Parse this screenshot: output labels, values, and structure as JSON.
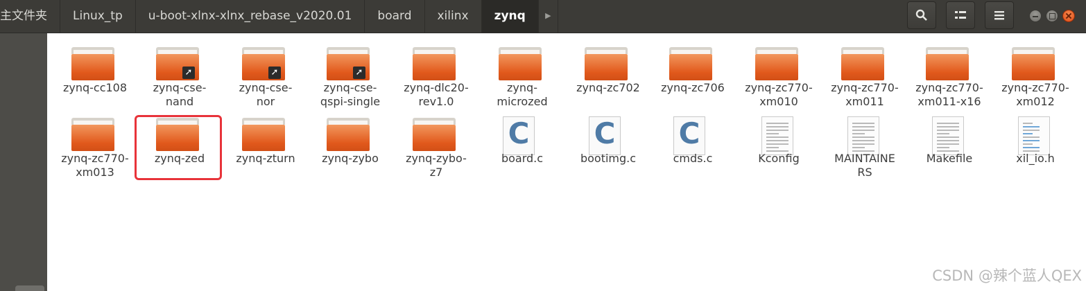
{
  "breadcrumbs": [
    "主文件夹",
    "Linux_tp",
    "u-boot-xlnx-xlnx_rebase_v2020.01",
    "board",
    "xilinx",
    "zynq"
  ],
  "active_crumb": "zynq",
  "toolbar": {
    "search_icon": "search-icon",
    "view_icon": "list-view-icon",
    "menu_icon": "hamburger-menu-icon"
  },
  "files": [
    {
      "name": "zynq-cc108",
      "type": "folder"
    },
    {
      "name": "zynq-cse-nand",
      "type": "folder-link"
    },
    {
      "name": "zynq-cse-nor",
      "type": "folder-link"
    },
    {
      "name": "zynq-cse-qspi-single",
      "type": "folder-link"
    },
    {
      "name": "zynq-dlc20-rev1.0",
      "type": "folder"
    },
    {
      "name": "zynq-microzed",
      "type": "folder"
    },
    {
      "name": "zynq-zc702",
      "type": "folder"
    },
    {
      "name": "zynq-zc706",
      "type": "folder"
    },
    {
      "name": "zynq-zc770-xm010",
      "type": "folder"
    },
    {
      "name": "zynq-zc770-xm011",
      "type": "folder"
    },
    {
      "name": "zynq-zc770-xm011-x16",
      "type": "folder"
    },
    {
      "name": "zynq-zc770-xm012",
      "type": "folder"
    },
    {
      "name": "zynq-zc770-xm013",
      "type": "folder"
    },
    {
      "name": "zynq-zed",
      "type": "folder"
    },
    {
      "name": "zynq-zturn",
      "type": "folder"
    },
    {
      "name": "zynq-zybo",
      "type": "folder"
    },
    {
      "name": "zynq-zybo-z7",
      "type": "folder"
    },
    {
      "name": "board.c",
      "type": "c-source"
    },
    {
      "name": "bootimg.c",
      "type": "c-source"
    },
    {
      "name": "cmds.c",
      "type": "c-source"
    },
    {
      "name": "Kconfig",
      "type": "text"
    },
    {
      "name": "MAINTAINERS",
      "type": "text"
    },
    {
      "name": "Makefile",
      "type": "text"
    },
    {
      "name": "xil_io.h",
      "type": "header"
    }
  ],
  "labels": [
    [
      "zynq-cc108"
    ],
    [
      "zynq-cse-",
      "nand"
    ],
    [
      "zynq-cse-",
      "nor"
    ],
    [
      "zynq-cse-",
      "qspi-single"
    ],
    [
      "zynq-dlc20-",
      "rev1.0"
    ],
    [
      "zynq-",
      "microzed"
    ],
    [
      "zynq-zc702"
    ],
    [
      "zynq-zc706"
    ],
    [
      "zynq-zc770-",
      "xm010"
    ],
    [
      "zynq-zc770-",
      "xm011"
    ],
    [
      "zynq-zc770-",
      "xm011-x16"
    ],
    [
      "zynq-zc770-",
      "xm012"
    ],
    [
      "zynq-zc770-",
      "xm013"
    ],
    [
      "zynq-zed"
    ],
    [
      "zynq-zturn"
    ],
    [
      "zynq-zybo"
    ],
    [
      "zynq-zybo-",
      "z7"
    ],
    [
      "board.c"
    ],
    [
      "bootimg.c"
    ],
    [
      "cmds.c"
    ],
    [
      "Kconfig"
    ],
    [
      "MAINTAINE",
      "RS"
    ],
    [
      "Makefile"
    ],
    [
      "xil_io.h"
    ]
  ],
  "highlighted": "zynq-zed",
  "watermark": "CSDN @辣个蓝人QEX",
  "colors": {
    "folder": "#e1591c",
    "highlight": "#e8333a",
    "header": "#3c3b37"
  }
}
